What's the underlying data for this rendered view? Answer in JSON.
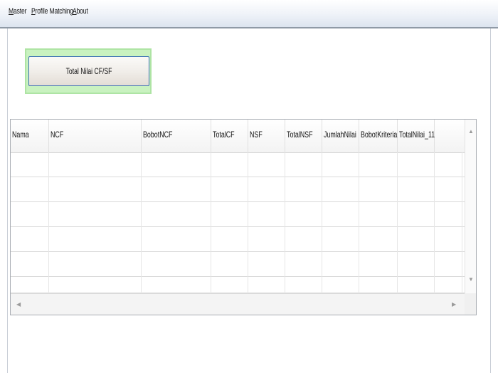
{
  "menu": {
    "items": [
      {
        "accel": "M",
        "rest": "aster"
      },
      {
        "accel": "P",
        "rest": "rofile Matching"
      },
      {
        "accel": "A",
        "rest": "bout"
      }
    ]
  },
  "toolbar": {
    "button_label": "Total Nilai CF/SF"
  },
  "grid": {
    "columns": [
      "Nama",
      "NCF",
      "BobotNCF",
      "TotalCF",
      "NSF",
      "TotalNSF",
      "JumlahNilai",
      "BobotKriteria",
      "TotalNilai_11"
    ],
    "rows": [
      [],
      [],
      [],
      [],
      [],
      []
    ]
  }
}
